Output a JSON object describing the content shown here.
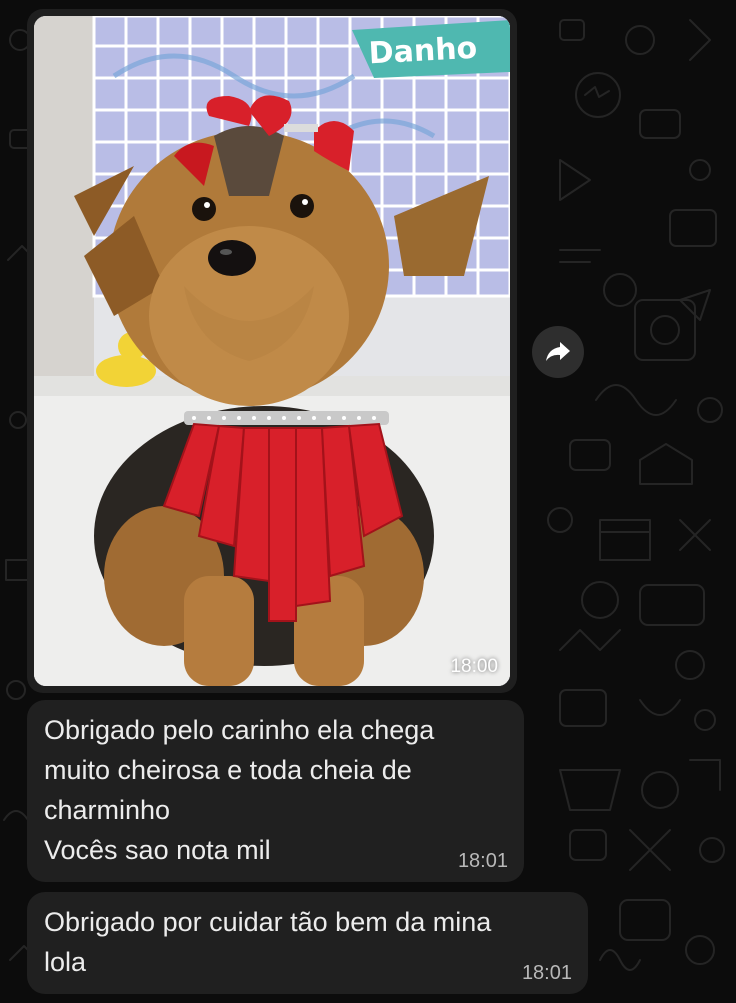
{
  "chat": {
    "messages": [
      {
        "kind": "image",
        "photo_sign": "Danho",
        "time": "18:00"
      },
      {
        "kind": "text",
        "text": "Obrigado pelo carinho ela chega\nmuito cheirosa e toda cheia de\ncharminho\nVocês sao nota mil",
        "time": "18:01"
      },
      {
        "kind": "text",
        "text": "Obrigado por cuidar tão bem da mina\nlola",
        "time": "18:01"
      }
    ]
  },
  "icons": {
    "forward": "forward-arrow-icon"
  },
  "colors": {
    "background": "#0c0c0c",
    "bubble": "#202020",
    "text": "#ececec",
    "timestamp": "#b8b8b8",
    "sign_teal": "#4fb8b0",
    "bow_red": "#d8202a"
  }
}
